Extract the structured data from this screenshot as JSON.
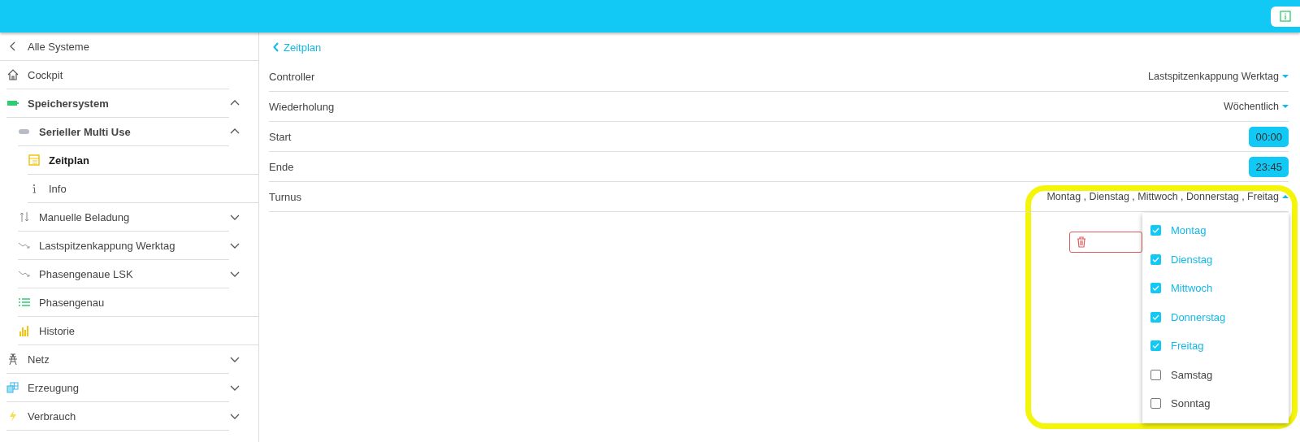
{
  "sidebar": {
    "back_link": {
      "label": "Alle Systeme"
    },
    "items": [
      {
        "label": "Cockpit",
        "selected": false
      },
      {
        "label": "Speichersystem",
        "selected": false,
        "expanded": true,
        "children": [
          {
            "label": "Serieller Multi Use",
            "selected": false,
            "expanded": true,
            "children": [
              {
                "label": "Zeitplan",
                "selected": true
              },
              {
                "label": "Info",
                "selected": false
              }
            ]
          },
          {
            "label": "Manuelle Beladung",
            "selected": false,
            "expanded": false
          },
          {
            "label": "Lastspitzenkappung Werktag",
            "selected": false,
            "expanded": false
          },
          {
            "label": "Phasengenaue LSK",
            "selected": false,
            "expanded": false
          },
          {
            "label": "Phasengenau",
            "selected": false
          },
          {
            "label": "Historie",
            "selected": false
          }
        ]
      },
      {
        "label": "Netz",
        "selected": false,
        "expanded": false
      },
      {
        "label": "Erzeugung",
        "selected": false,
        "expanded": false
      },
      {
        "label": "Verbrauch",
        "selected": false,
        "expanded": false
      }
    ]
  },
  "content": {
    "back_link": {
      "label": "Zeitplan"
    },
    "rows": [
      {
        "label": "Controller",
        "kind": "select",
        "value": "Lastspitzenkappung Werktag",
        "expanded": false
      },
      {
        "label": "Wiederholung",
        "kind": "select",
        "value": "Wöchentlich",
        "expanded": false
      },
      {
        "label": "Start",
        "kind": "time",
        "value": "00:00"
      },
      {
        "label": "Ende",
        "kind": "time",
        "value": "23:45"
      },
      {
        "label": "Turnus",
        "kind": "select",
        "value": "Montag , Dienstag , Mittwoch , Donnerstag , Freitag",
        "expanded": true,
        "options": [
          {
            "label": "Montag",
            "checked": true
          },
          {
            "label": "Dienstag",
            "checked": true
          },
          {
            "label": "Mittwoch",
            "checked": true
          },
          {
            "label": "Donnerstag",
            "checked": true
          },
          {
            "label": "Freitag",
            "checked": true
          },
          {
            "label": "Samstag",
            "checked": false
          },
          {
            "label": "Sonntag",
            "checked": false
          }
        ]
      }
    ]
  }
}
